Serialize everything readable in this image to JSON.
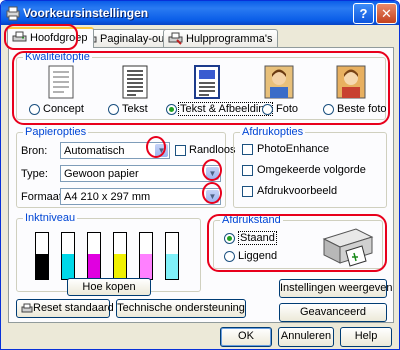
{
  "window": {
    "title": "Voorkeursinstellingen"
  },
  "tabs": [
    {
      "label": "Hoofdgroep"
    },
    {
      "label": "Paginalay-out"
    },
    {
      "label": "Hulpprogramma's"
    }
  ],
  "quality": {
    "legend": "Kwaliteitoptie",
    "options": [
      {
        "label": "Concept",
        "icon": "draft-document-icon",
        "selected": false
      },
      {
        "label": "Tekst",
        "icon": "text-document-icon",
        "selected": false
      },
      {
        "label": "Tekst & Afbeelding",
        "icon": "text-image-document-icon",
        "selected": true
      },
      {
        "label": "Foto",
        "icon": "photo-icon",
        "selected": false
      },
      {
        "label": "Beste foto",
        "icon": "best-photo-icon",
        "selected": false
      }
    ]
  },
  "paper": {
    "legend": "Papieropties",
    "source_label": "Bron:",
    "source_value": "Automatisch",
    "borderless_label": "Randloos",
    "type_label": "Type:",
    "type_value": "Gewoon papier",
    "format_label": "Formaat:",
    "format_value": "A4 210 x 297 mm"
  },
  "print_options": {
    "legend": "Afdrukopties",
    "items": [
      "PhotoEnhance",
      "Omgekeerde volgorde",
      "Afdrukvoorbeeld"
    ]
  },
  "ink": {
    "legend": "Inktniveau",
    "levels": [
      {
        "color": "#000000",
        "level": 0.55
      },
      {
        "color": "#00d8e8",
        "level": 0.55
      },
      {
        "color": "#e000e0",
        "level": 0.55
      },
      {
        "color": "#f0f000",
        "level": 0.55
      },
      {
        "color": "#ff80ff",
        "level": 0.55
      },
      {
        "color": "#80f0f8",
        "level": 0.55
      }
    ],
    "buy_button": "Hoe kopen"
  },
  "orientation": {
    "legend": "Afdrukstand",
    "portrait": "Staand",
    "landscape": "Liggend",
    "selected": "portrait"
  },
  "buttons": {
    "show_settings": "Instellingen weergeven",
    "advanced": "Geavanceerd",
    "reset": "Reset standaard",
    "support": "Technische ondersteuning",
    "ok": "OK",
    "cancel": "Annuleren",
    "help": "Help"
  },
  "colors": {
    "highlight_ring": "#e8001c",
    "group_legend": "#0046d5"
  }
}
